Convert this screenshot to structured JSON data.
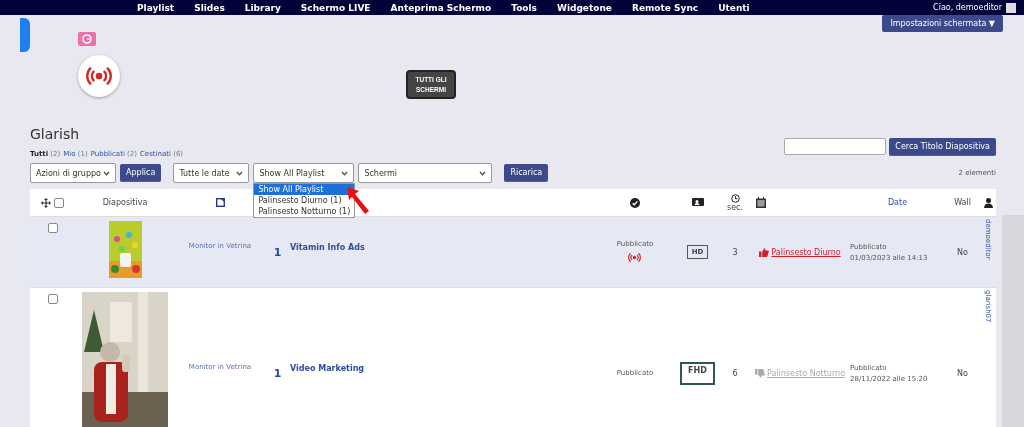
{
  "nav": {
    "items": [
      "Playlist",
      "Slides",
      "Library",
      "Schermo LIVE",
      "Anteprima Schermo",
      "Tools",
      "Widgetone",
      "Remote Sync",
      "Utenti"
    ],
    "greeting": "Ciao, demoeditor"
  },
  "screen_settings": "Impostazioni schermata ▼",
  "all_screens_button": "TUTTI GLI SCHERMI",
  "title": "Glarish",
  "filters": [
    {
      "label": "Tutti",
      "count": "(2)",
      "selected": true
    },
    {
      "label": "Mio",
      "count": "(1)",
      "selected": false
    },
    {
      "label": "Pubblicati",
      "count": "(2)",
      "selected": false
    },
    {
      "label": "Cestinati",
      "count": "(6)",
      "selected": false
    }
  ],
  "search": {
    "button": "Cerca Titolo Diapositiva"
  },
  "toolbar": {
    "bulk_actions": "Azioni di gruppo",
    "apply": "Applica",
    "dates": "Tutte le date",
    "playlist": "Show All Playlist",
    "screens": "Schermi",
    "reload": "Ricarica",
    "count": "2 elementi"
  },
  "playlist_dropdown": [
    {
      "label": "Show All Playlist",
      "selected": true
    },
    {
      "label": "Palinsesto Diurno (1)",
      "selected": false
    },
    {
      "label": "Palinsesto Notturno (1)",
      "selected": false
    }
  ],
  "select_all_checked": false,
  "columns": {
    "slide": "Diapositiva",
    "seconds": "sec.",
    "date": "Date",
    "wall": "Wall"
  },
  "rows": [
    {
      "highlighted": true,
      "checked": false,
      "picture": {
        "kind": "poster"
      },
      "screen": "Monitor in Vetrina",
      "count": "1",
      "title": "Vitamin Info Ads",
      "status": "Pubblicato",
      "live": true,
      "resolution": "HD",
      "seconds": "3",
      "schedule": {
        "label": "Palinsesto Diurno",
        "active": true
      },
      "date_status": "Pubblicato",
      "date": "01/03/2023 alle 14:13",
      "wall": "No",
      "author": "demoeditor"
    },
    {
      "highlighted": false,
      "checked": false,
      "picture": {
        "kind": "video"
      },
      "screen": "Monitor in Vetrina",
      "count": "1",
      "title": "Video Marketing",
      "status": "Pubblicato",
      "live": false,
      "resolution": "FHD",
      "seconds": "6",
      "schedule": {
        "label": "Palinsesto Notturno",
        "active": false
      },
      "date_status": "Pubblicato",
      "date": "28/11/2022 alle 15:20",
      "wall": "No",
      "author": "glarish07"
    }
  ]
}
